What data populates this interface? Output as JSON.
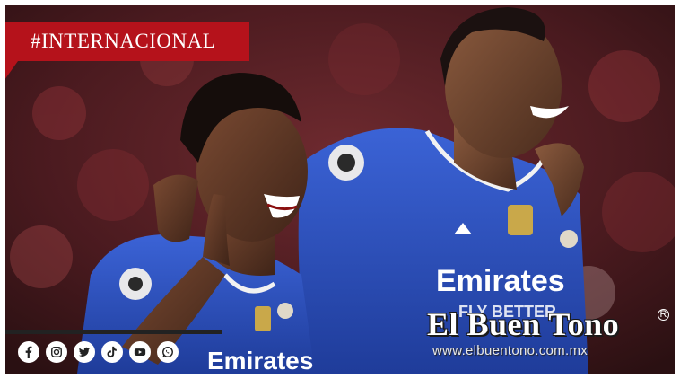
{
  "tag": {
    "label": "#INTERNACIONAL"
  },
  "brand": {
    "name": "El Buen Tono",
    "registered": "R",
    "url": "www.elbuentono.com.mx"
  },
  "social": {
    "icons": [
      "facebook-icon",
      "instagram-icon",
      "twitter-icon",
      "tiktok-icon",
      "youtube-icon",
      "whatsapp-icon"
    ]
  },
  "photo": {
    "jersey_texts": [
      "Emirates",
      "FLY BETTER",
      "Emirates"
    ],
    "colors": {
      "jersey": "#2f55c8",
      "stripe": "#b5121b",
      "crowd": "#5a1c22"
    }
  }
}
